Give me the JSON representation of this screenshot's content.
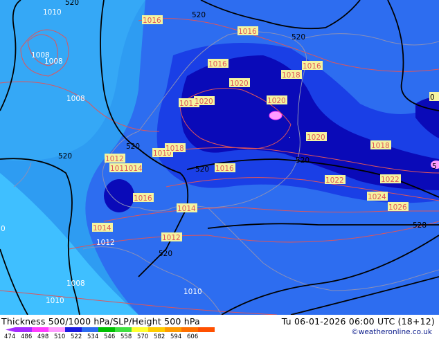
{
  "map": {
    "colors": {
      "ocean_far": "#2e9cf2",
      "light_band": "#3fbfff",
      "mid_blue": "#2d6df0",
      "deep_blue": "#1a3fe6",
      "darkest": "#0a0ab8",
      "land_line": "#8a8fb8",
      "isobar": "#e0555a",
      "height": "#000000"
    },
    "height_labels": [
      "520",
      "520",
      "520",
      "520",
      "520",
      "520",
      "520",
      "520",
      "528"
    ],
    "isobar_labels": [
      "1010",
      "1016",
      "1008",
      "1008",
      "1008",
      "1016",
      "1016",
      "1018",
      "1016",
      "1020",
      "1020",
      "1011",
      "1020",
      "1020",
      "1012",
      "1010",
      "1018",
      "1016",
      "1014",
      "1016",
      "1020",
      "1018",
      "1022",
      "1022",
      "1024",
      "1026",
      "1016",
      "1014",
      "1014",
      "1012",
      "1012",
      "1008",
      "1010",
      "1010",
      "1010",
      "1016",
      "1016"
    ],
    "partial_labels": [
      "0",
      "5",
      "0"
    ]
  },
  "footer": {
    "title": "Thickness 500/1000 hPa/SLP/Height 500 hPa",
    "valid_time": "Tu 06-01-2026 06:00 UTC (18+12)",
    "credit": "©weatheronline.co.uk",
    "scale_values": [
      "474",
      "486",
      "498",
      "510",
      "522",
      "534",
      "546",
      "558",
      "570",
      "582",
      "594",
      "606"
    ],
    "scale_colors": [
      "#a52aff",
      "#ff3cff",
      "#ff9cff",
      "#1a1ae0",
      "#2d6df0",
      "#00c000",
      "#40e040",
      "#ffff30",
      "#ffcc00",
      "#ff9a00",
      "#ff7000",
      "#ff5000"
    ]
  }
}
